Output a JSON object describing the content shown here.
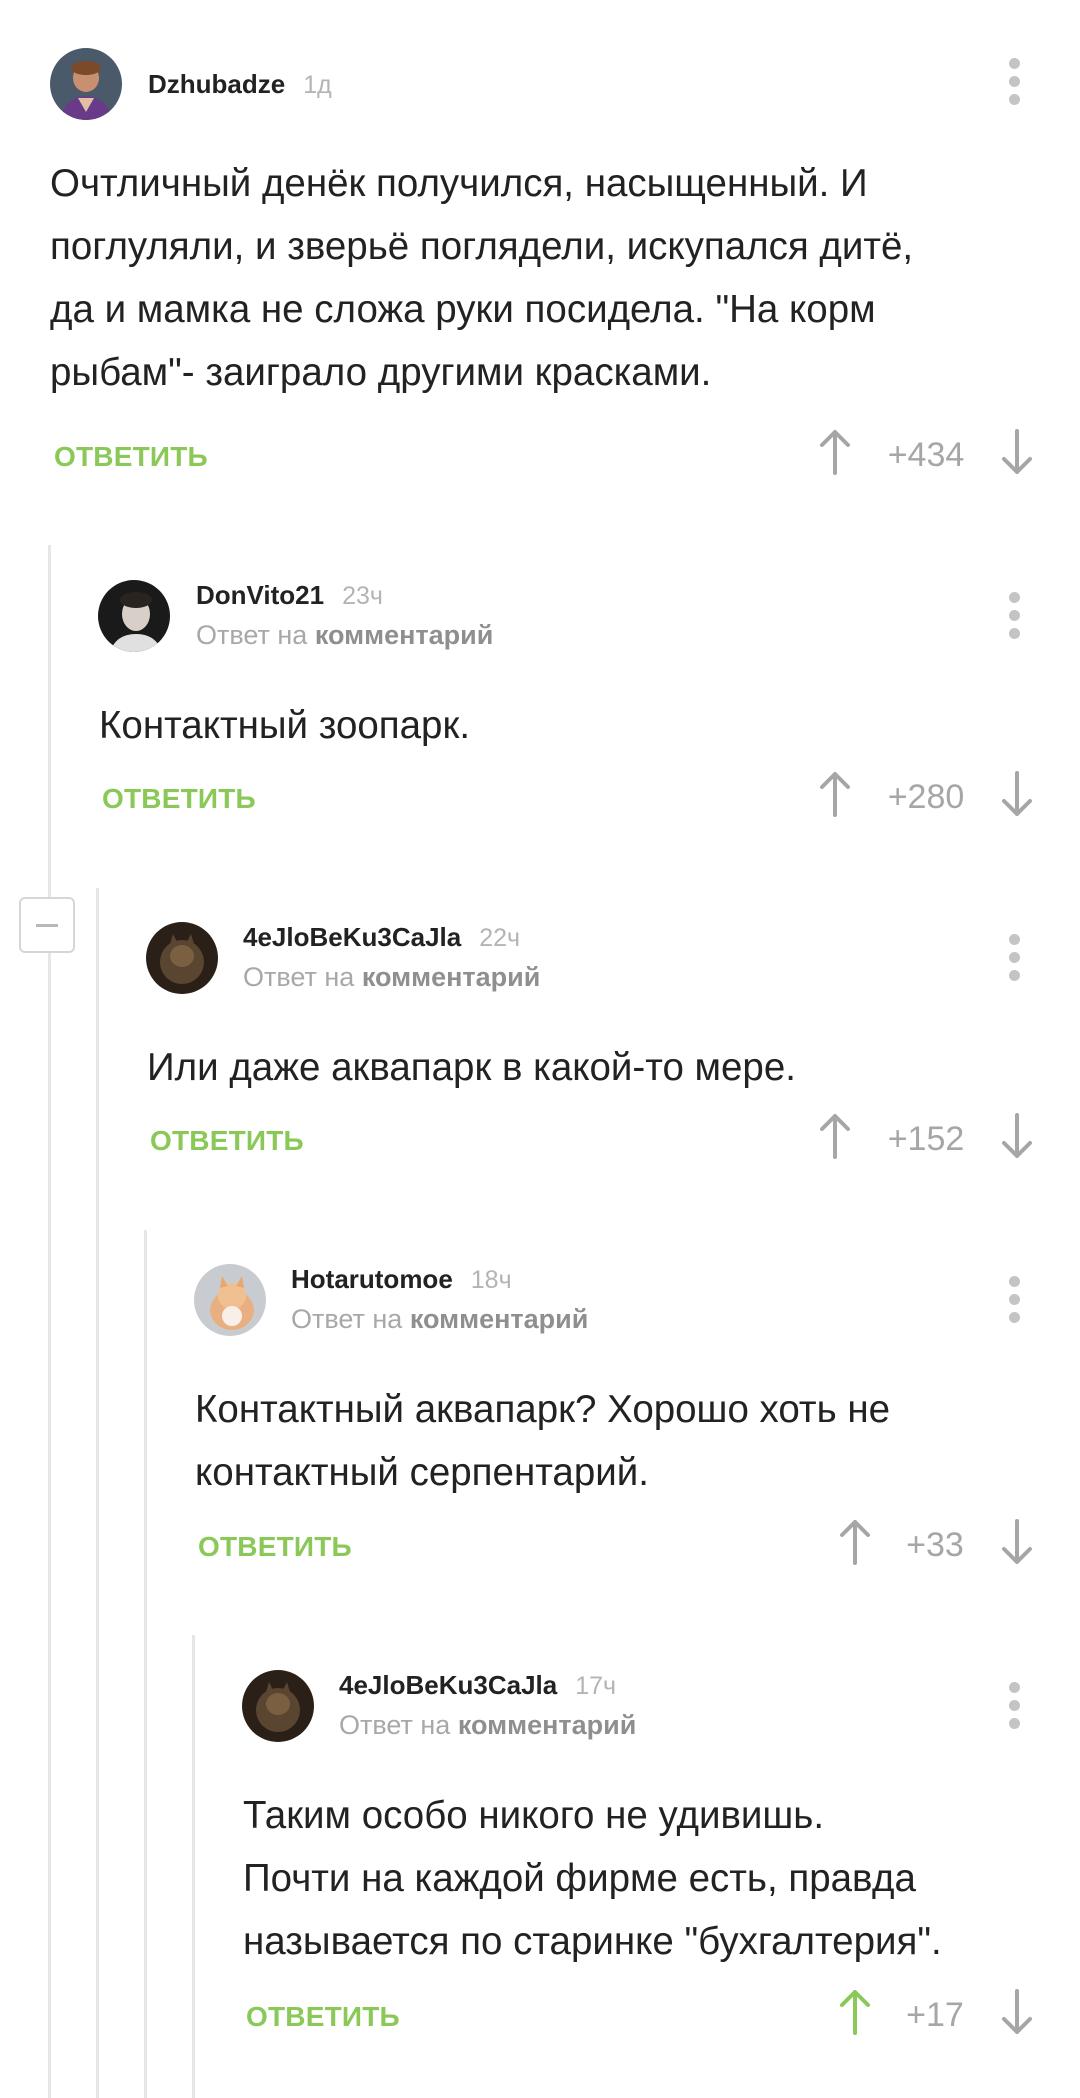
{
  "comments": [
    {
      "username": "Dzhubadze",
      "time": "1д",
      "reply_to": null,
      "body_lines": [
        "Очтличный денёк получился, насыщенный. И",
        "поглуляли, и зверьё поглядели, искупался дитё,",
        "да и мамка не сложа руки посидела. \"На корм",
        "рыбам\"- заиграло другими красками."
      ],
      "reply_label": "ОТВЕТИТЬ",
      "score": "+434",
      "upvoted": false
    },
    {
      "username": "DonVito21",
      "time": "23ч",
      "reply_to": {
        "prefix": "Ответ на",
        "link": "комментарий"
      },
      "body_lines": [
        "Контактный зоопарк."
      ],
      "reply_label": "ОТВЕТИТЬ",
      "score": "+280",
      "upvoted": false
    },
    {
      "username": "4eJloBeKu3CaJla",
      "time": "22ч",
      "reply_to": {
        "prefix": "Ответ на",
        "link": "комментарий"
      },
      "body_lines": [
        "Или даже аквапарк в какой-то мере."
      ],
      "reply_label": "ОТВЕТИТЬ",
      "score": "+152",
      "upvoted": false
    },
    {
      "username": "Hotarutomoe",
      "time": "18ч",
      "reply_to": {
        "prefix": "Ответ на",
        "link": "комментарий"
      },
      "body_lines": [
        "Контактный аквапарк? Хорошо хоть не",
        "контактный серпентарий."
      ],
      "reply_label": "ОТВЕТИТЬ",
      "score": "+33",
      "upvoted": false
    },
    {
      "username": "4eJloBeKu3CaJla",
      "time": "17ч",
      "reply_to": {
        "prefix": "Ответ на",
        "link": "комментарий"
      },
      "body_lines": [
        "Таким особо никого не удивишь.",
        "Почти на каждой фирме есть, правда",
        "называется по старинке \"бухгалтерия\"."
      ],
      "reply_label": "ОТВЕТИТЬ",
      "score": "+17",
      "upvoted": true
    }
  ],
  "colors": {
    "accent_green": "#8ac858",
    "vote_grey": "#a6a6a6",
    "thread_line": "#e6e6e6"
  }
}
